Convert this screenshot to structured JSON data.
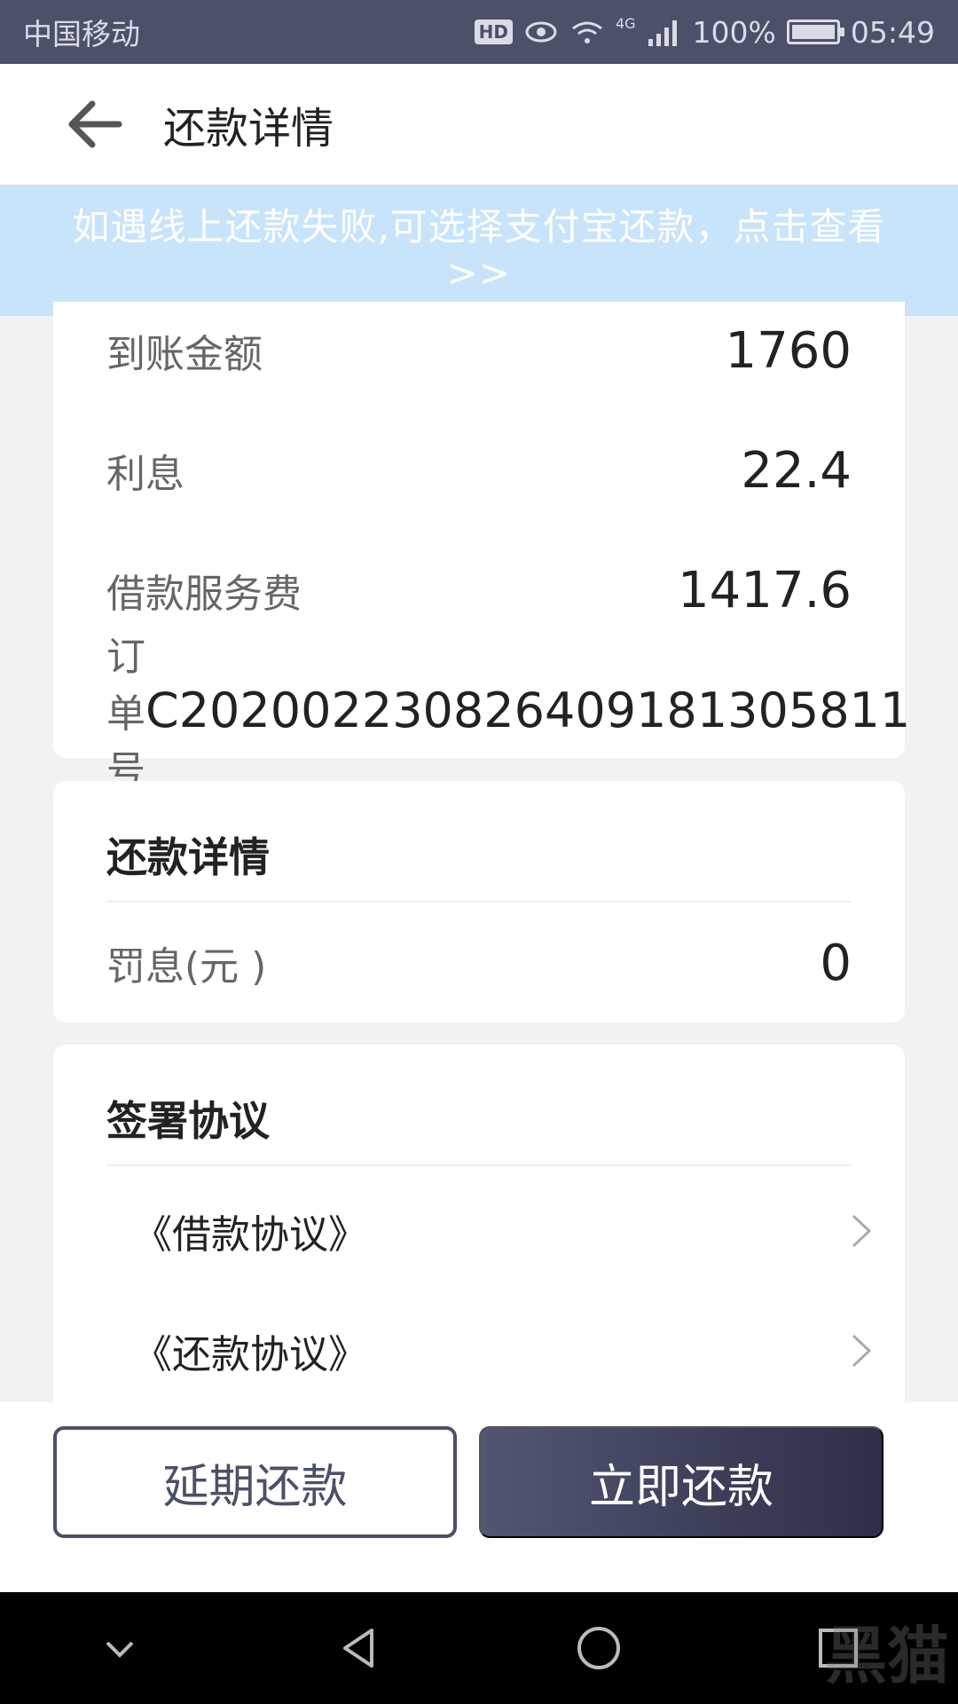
{
  "status_bar": {
    "carrier": "中国移动",
    "hd": "HD",
    "network": "4G",
    "battery": "100%",
    "time": "05:49"
  },
  "header": {
    "title": "还款详情",
    "back_icon": "arrow-left-icon"
  },
  "notice": {
    "text": "如遇线上还款失败,可选择支付宝还款，点击查看 >>"
  },
  "loan_details": [
    {
      "label": "到账金额",
      "value": "1760"
    },
    {
      "label": "利息",
      "value": "22.4"
    },
    {
      "label": "借款服务费",
      "value": "1417.6"
    },
    {
      "label": "订单号",
      "value": "C202002230826409181305811"
    }
  ],
  "repay_section": {
    "title": "还款详情",
    "penalty_label": "罚息(元 )",
    "penalty_value": "0"
  },
  "sign_section": {
    "title": "签署协议",
    "items": [
      {
        "label": "《借款协议》"
      },
      {
        "label": "《还款协议》"
      }
    ]
  },
  "actions": {
    "extend_label": "延期还款",
    "pay_label": "立即还款"
  },
  "watermark": {
    "text": "黑猫"
  },
  "colors": {
    "status_bar": "#4c5068",
    "banner": "#c8e4fb",
    "primary": "#2e2f47"
  }
}
